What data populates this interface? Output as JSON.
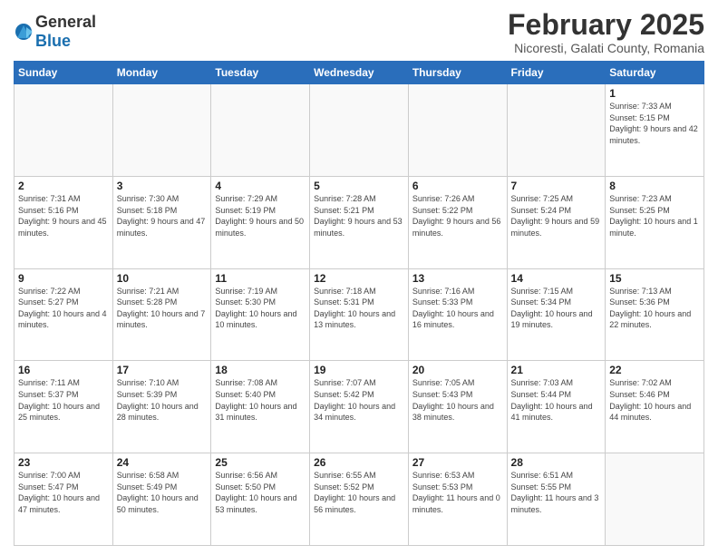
{
  "header": {
    "logo": {
      "general": "General",
      "blue": "Blue"
    },
    "title": "February 2025",
    "location": "Nicoresti, Galati County, Romania"
  },
  "calendar": {
    "days_of_week": [
      "Sunday",
      "Monday",
      "Tuesday",
      "Wednesday",
      "Thursday",
      "Friday",
      "Saturday"
    ],
    "weeks": [
      {
        "days": [
          {
            "num": "",
            "info": ""
          },
          {
            "num": "",
            "info": ""
          },
          {
            "num": "",
            "info": ""
          },
          {
            "num": "",
            "info": ""
          },
          {
            "num": "",
            "info": ""
          },
          {
            "num": "",
            "info": ""
          },
          {
            "num": "1",
            "info": "Sunrise: 7:33 AM\nSunset: 5:15 PM\nDaylight: 9 hours and 42 minutes."
          }
        ]
      },
      {
        "days": [
          {
            "num": "2",
            "info": "Sunrise: 7:31 AM\nSunset: 5:16 PM\nDaylight: 9 hours and 45 minutes."
          },
          {
            "num": "3",
            "info": "Sunrise: 7:30 AM\nSunset: 5:18 PM\nDaylight: 9 hours and 47 minutes."
          },
          {
            "num": "4",
            "info": "Sunrise: 7:29 AM\nSunset: 5:19 PM\nDaylight: 9 hours and 50 minutes."
          },
          {
            "num": "5",
            "info": "Sunrise: 7:28 AM\nSunset: 5:21 PM\nDaylight: 9 hours and 53 minutes."
          },
          {
            "num": "6",
            "info": "Sunrise: 7:26 AM\nSunset: 5:22 PM\nDaylight: 9 hours and 56 minutes."
          },
          {
            "num": "7",
            "info": "Sunrise: 7:25 AM\nSunset: 5:24 PM\nDaylight: 9 hours and 59 minutes."
          },
          {
            "num": "8",
            "info": "Sunrise: 7:23 AM\nSunset: 5:25 PM\nDaylight: 10 hours and 1 minute."
          }
        ]
      },
      {
        "days": [
          {
            "num": "9",
            "info": "Sunrise: 7:22 AM\nSunset: 5:27 PM\nDaylight: 10 hours and 4 minutes."
          },
          {
            "num": "10",
            "info": "Sunrise: 7:21 AM\nSunset: 5:28 PM\nDaylight: 10 hours and 7 minutes."
          },
          {
            "num": "11",
            "info": "Sunrise: 7:19 AM\nSunset: 5:30 PM\nDaylight: 10 hours and 10 minutes."
          },
          {
            "num": "12",
            "info": "Sunrise: 7:18 AM\nSunset: 5:31 PM\nDaylight: 10 hours and 13 minutes."
          },
          {
            "num": "13",
            "info": "Sunrise: 7:16 AM\nSunset: 5:33 PM\nDaylight: 10 hours and 16 minutes."
          },
          {
            "num": "14",
            "info": "Sunrise: 7:15 AM\nSunset: 5:34 PM\nDaylight: 10 hours and 19 minutes."
          },
          {
            "num": "15",
            "info": "Sunrise: 7:13 AM\nSunset: 5:36 PM\nDaylight: 10 hours and 22 minutes."
          }
        ]
      },
      {
        "days": [
          {
            "num": "16",
            "info": "Sunrise: 7:11 AM\nSunset: 5:37 PM\nDaylight: 10 hours and 25 minutes."
          },
          {
            "num": "17",
            "info": "Sunrise: 7:10 AM\nSunset: 5:39 PM\nDaylight: 10 hours and 28 minutes."
          },
          {
            "num": "18",
            "info": "Sunrise: 7:08 AM\nSunset: 5:40 PM\nDaylight: 10 hours and 31 minutes."
          },
          {
            "num": "19",
            "info": "Sunrise: 7:07 AM\nSunset: 5:42 PM\nDaylight: 10 hours and 34 minutes."
          },
          {
            "num": "20",
            "info": "Sunrise: 7:05 AM\nSunset: 5:43 PM\nDaylight: 10 hours and 38 minutes."
          },
          {
            "num": "21",
            "info": "Sunrise: 7:03 AM\nSunset: 5:44 PM\nDaylight: 10 hours and 41 minutes."
          },
          {
            "num": "22",
            "info": "Sunrise: 7:02 AM\nSunset: 5:46 PM\nDaylight: 10 hours and 44 minutes."
          }
        ]
      },
      {
        "days": [
          {
            "num": "23",
            "info": "Sunrise: 7:00 AM\nSunset: 5:47 PM\nDaylight: 10 hours and 47 minutes."
          },
          {
            "num": "24",
            "info": "Sunrise: 6:58 AM\nSunset: 5:49 PM\nDaylight: 10 hours and 50 minutes."
          },
          {
            "num": "25",
            "info": "Sunrise: 6:56 AM\nSunset: 5:50 PM\nDaylight: 10 hours and 53 minutes."
          },
          {
            "num": "26",
            "info": "Sunrise: 6:55 AM\nSunset: 5:52 PM\nDaylight: 10 hours and 56 minutes."
          },
          {
            "num": "27",
            "info": "Sunrise: 6:53 AM\nSunset: 5:53 PM\nDaylight: 11 hours and 0 minutes."
          },
          {
            "num": "28",
            "info": "Sunrise: 6:51 AM\nSunset: 5:55 PM\nDaylight: 11 hours and 3 minutes."
          },
          {
            "num": "",
            "info": ""
          }
        ]
      }
    ]
  }
}
